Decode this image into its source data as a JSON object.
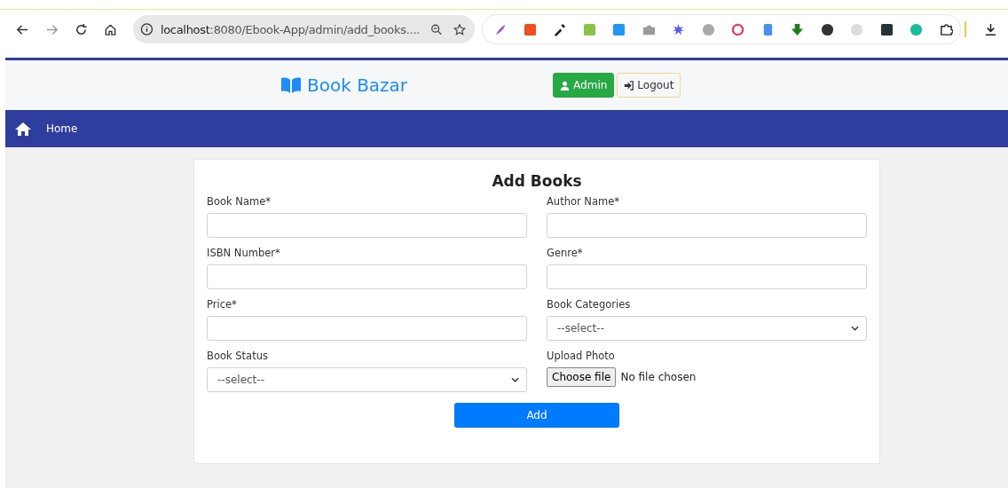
{
  "browser": {
    "url_host": "localhost",
    "url_rest": ":8080/Ebook-App/admin/add_books...."
  },
  "header": {
    "brand": "Book Bazar",
    "admin_button": "Admin",
    "logout_button": "Logout"
  },
  "nav": {
    "items": [
      {
        "label": "Home"
      }
    ]
  },
  "form": {
    "title": "Add Books",
    "fields": [
      {
        "kind": "text",
        "label": "Book Name*"
      },
      {
        "kind": "text",
        "label": "Author Name*"
      },
      {
        "kind": "text",
        "label": "ISBN Number*"
      },
      {
        "kind": "text",
        "label": "Genre*"
      },
      {
        "kind": "text",
        "label": "Price*"
      },
      {
        "kind": "select",
        "label": "Book Categories",
        "value": "--select--"
      },
      {
        "kind": "select",
        "label": "Book Status",
        "value": "--select--"
      },
      {
        "kind": "file",
        "label": "Upload Photo",
        "button": "Choose file",
        "status": "No file chosen"
      }
    ],
    "submit": "Add"
  }
}
